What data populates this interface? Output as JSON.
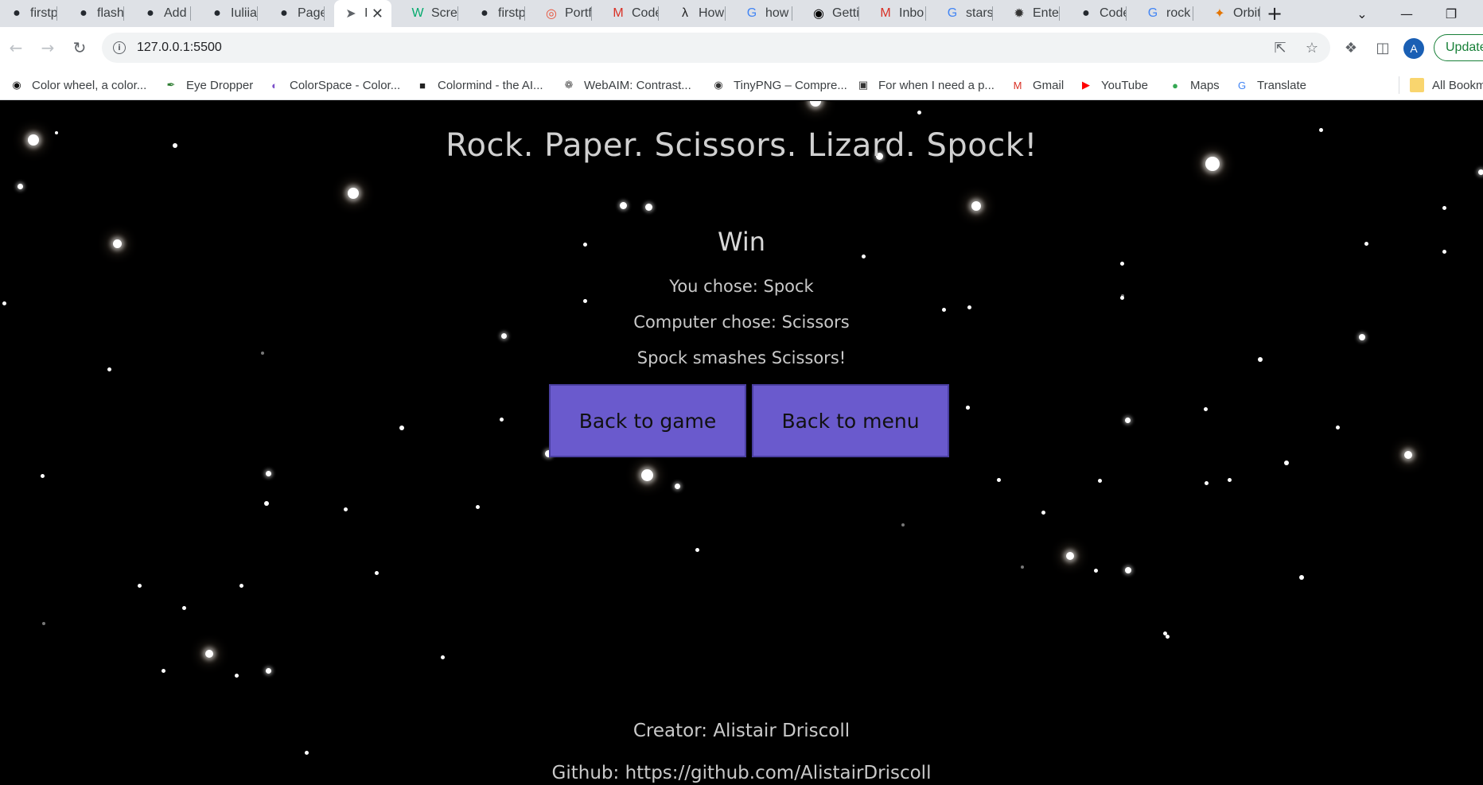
{
  "browser": {
    "tabs": [
      {
        "label": "firstp",
        "icon": "github-icon"
      },
      {
        "label": "flash_",
        "icon": "github-icon"
      },
      {
        "label": "Add",
        "icon": "github-icon"
      },
      {
        "label": "Iuliia",
        "icon": "github-icon"
      },
      {
        "label": "Page",
        "icon": "github-icon"
      },
      {
        "label": "I",
        "icon": "rocket-icon"
      },
      {
        "label": "Scree",
        "icon": "w3-icon"
      },
      {
        "label": "firstp",
        "icon": "github-icon"
      },
      {
        "label": "Portf",
        "icon": "target-icon"
      },
      {
        "label": "Code",
        "icon": "gmail-icon"
      },
      {
        "label": "How",
        "icon": "dev-icon"
      },
      {
        "label": "how",
        "icon": "google-icon"
      },
      {
        "label": "Getti",
        "icon": "medium-icon"
      },
      {
        "label": "Inbo",
        "icon": "gmail-icon"
      },
      {
        "label": "stars",
        "icon": "google-icon"
      },
      {
        "label": "Enter",
        "icon": "chatgpt-icon"
      },
      {
        "label": "Code",
        "icon": "github-icon"
      },
      {
        "label": "rock",
        "icon": "google-icon"
      },
      {
        "label": "Orbit",
        "icon": "orbit-icon"
      }
    ],
    "active_tab_index": 5,
    "new_tab_symbol": "+",
    "url": "127.0.0.1:5500",
    "profile_initial": "A",
    "update_label": "Update",
    "bookmarks": [
      {
        "label": "Color wheel, a color...",
        "icon": "colorwheel-icon"
      },
      {
        "label": "Eye Dropper",
        "icon": "eyedropper-icon"
      },
      {
        "label": "ColorSpace - Color...",
        "icon": "planet-icon"
      },
      {
        "label": "Colormind - the AI...",
        "icon": "colormind-icon"
      },
      {
        "label": "WebAIM: Contrast...",
        "icon": "webaim-icon"
      },
      {
        "label": "TinyPNG – Compre...",
        "icon": "panda-icon"
      },
      {
        "label": "For when I need a p...",
        "icon": "image-icon"
      },
      {
        "label": "Gmail",
        "icon": "gmail-icon"
      },
      {
        "label": "YouTube",
        "icon": "youtube-icon"
      },
      {
        "label": "Maps",
        "icon": "maps-icon"
      },
      {
        "label": "Translate",
        "icon": "translate-icon"
      }
    ],
    "all_bookmarks_label": "All Bookm"
  },
  "game": {
    "title": "Rock. Paper. Scissors. Lizard. Spock!",
    "result": "Win",
    "you_chose": "You chose: Spock",
    "computer_chose": "Computer chose: Scissors",
    "outcome": "Spock smashes Scissors!",
    "back_to_game": "Back to game",
    "back_to_menu": "Back to menu",
    "creator": "Creator: Alistair Driscoll",
    "github": "Github: https://github.com/AlistairDriscoll"
  },
  "colors": {
    "background": "#000000",
    "text": "#c9c9c9",
    "button": "#6a5acd"
  }
}
